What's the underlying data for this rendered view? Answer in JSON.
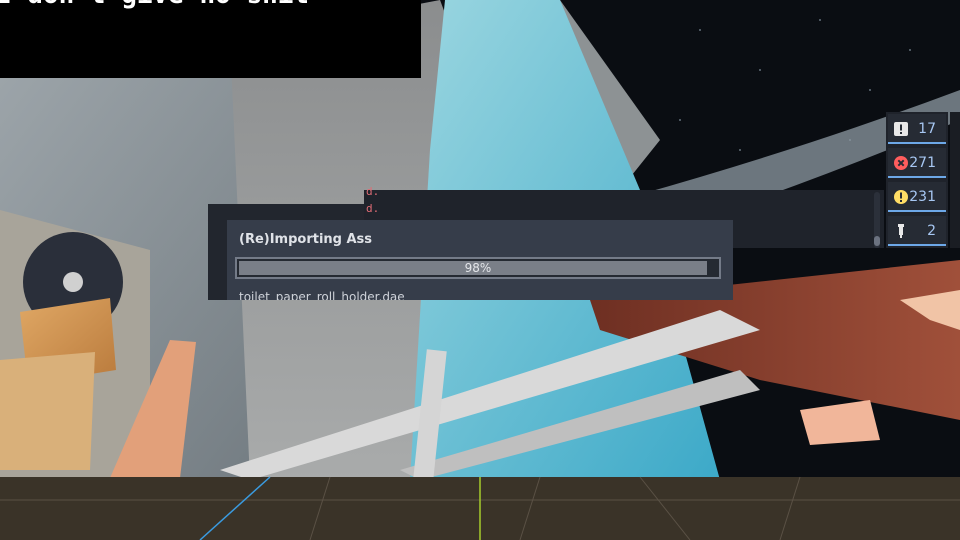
{
  "banner": {
    "text": "I don't give no shit"
  },
  "log": {
    "lines": [
      "d.",
      "d.",
      "d.",
      "d."
    ]
  },
  "filters": [
    {
      "name": "messages-filter-button",
      "icon": "message-icon",
      "count": "17",
      "color": "#e8e8e8"
    },
    {
      "name": "errors-filter-button",
      "icon": "error-icon",
      "count": "271",
      "color": "#ff5d5d"
    },
    {
      "name": "warnings-filter-button",
      "icon": "warning-icon",
      "count": "231",
      "color": "#ffdd65"
    },
    {
      "name": "editor-messages-filter-button",
      "icon": "editor-message-icon",
      "count": "2",
      "color": "#e8e8e8"
    }
  ],
  "dialog": {
    "title": "(Re)Importing Ass",
    "progress_label": "98%",
    "progress_fraction": 0.98,
    "current_file": "toilet_paper_roll_holder.dae"
  }
}
